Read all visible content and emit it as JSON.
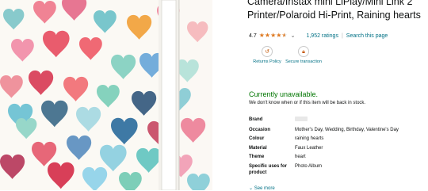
{
  "product": {
    "title": "Camera/Instax mini LiPlay/Mini Link 2 Printer/Polaroid Hi-Print, Raining hearts",
    "rating_value": "4.7",
    "ratings_count": "1,952 ratings",
    "search_link": "Search this page",
    "star_color": "#de7921",
    "link_color": "#007185"
  },
  "features": [
    {
      "label": "Returns Policy",
      "icon": "return-box-icon"
    },
    {
      "label": "Secure transaction",
      "icon": "lock-icon"
    }
  ],
  "availability": {
    "status": "Currently unavailable.",
    "note": "We don't know when or if this item will be back in stock.",
    "status_color": "#007600"
  },
  "specs": [
    {
      "key": "Brand",
      "value": ""
    },
    {
      "key": "Occasion",
      "value": "Mother's Day, Wedding, Birthday, Valentine's Day"
    },
    {
      "key": "Colour",
      "value": "raining hearts"
    },
    {
      "key": "Material",
      "value": "Faux Leather"
    },
    {
      "key": "Theme",
      "value": "heart"
    },
    {
      "key": "Specific uses for product",
      "value": "Photo Album"
    }
  ],
  "see_more": "See more"
}
